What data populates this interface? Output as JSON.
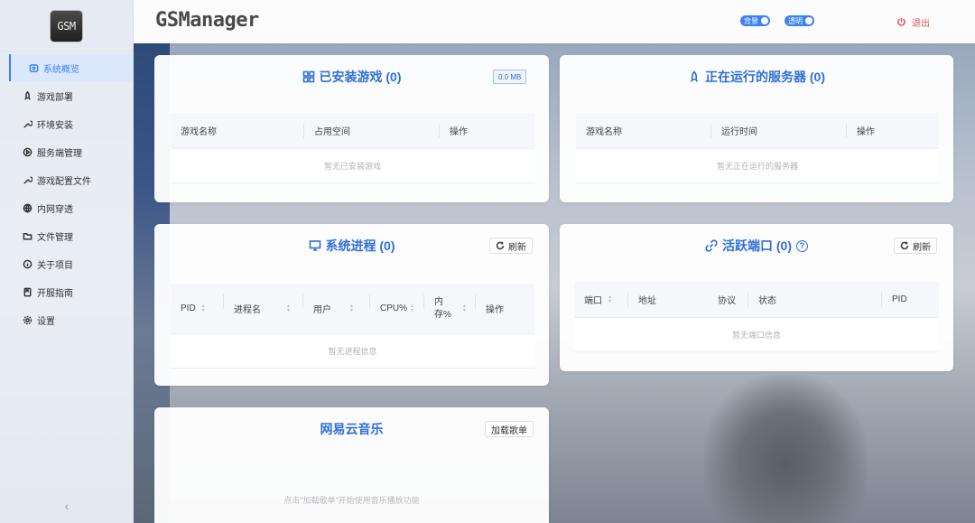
{
  "sidebar": {
    "logo_text": "GSM",
    "items": [
      {
        "label": "系统概览",
        "icon": "dashboard-icon"
      },
      {
        "label": "游戏部署",
        "icon": "rocket-icon"
      },
      {
        "label": "环境安装",
        "icon": "wrench-icon"
      },
      {
        "label": "服务端管理",
        "icon": "play-circle-icon"
      },
      {
        "label": "游戏配置文件",
        "icon": "wrench-icon"
      },
      {
        "label": "内网穿透",
        "icon": "globe-icon"
      },
      {
        "label": "文件管理",
        "icon": "folder-icon"
      },
      {
        "label": "关于项目",
        "icon": "info-icon"
      },
      {
        "label": "开服指南",
        "icon": "book-icon"
      },
      {
        "label": "设置",
        "icon": "gear-icon"
      }
    ],
    "active_index": 0,
    "collapse_label": "‹"
  },
  "header": {
    "brand": "GSManager",
    "toggle_bg": "背景",
    "toggle_transparent": "透明",
    "logout": "退出"
  },
  "cards": {
    "installed": {
      "title": "已安装游戏 (0)",
      "size": "0.0 MB",
      "columns": [
        "游戏名称",
        "占用空间",
        "操作"
      ],
      "empty": "暂无已安装游戏"
    },
    "running": {
      "title": "正在运行的服务器 (0)",
      "columns": [
        "游戏名称",
        "运行时间",
        "操作"
      ],
      "empty": "暂无正在运行的服务器"
    },
    "process": {
      "title": "系统进程 (0)",
      "refresh": "刷新",
      "columns": [
        "PID",
        "进程名",
        "用户",
        "CPU%",
        "内\n存%",
        "操作"
      ],
      "empty": "暂无进程信息"
    },
    "ports": {
      "title": "活跃端口 (0)",
      "refresh": "刷新",
      "columns": [
        "端口",
        "地址",
        "协议",
        "状态",
        "PID"
      ],
      "empty": "暂无端口信息"
    },
    "music": {
      "title": "网易云音乐",
      "load": "加载歌单",
      "hint": "点击\"加载歌单\"开始使用音乐播放功能"
    }
  },
  "colors": {
    "accent": "#3b82f6",
    "title": "#2f6fd6",
    "danger": "#e25555"
  }
}
